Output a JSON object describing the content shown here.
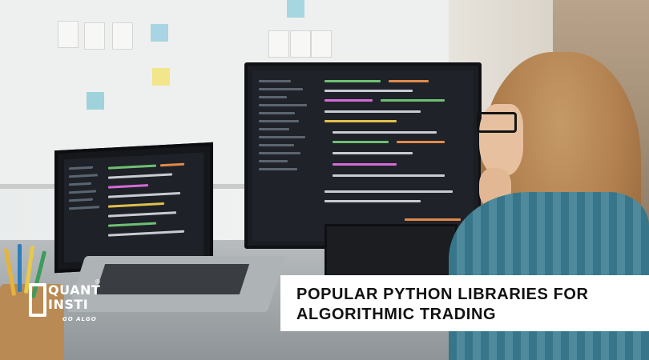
{
  "logo": {
    "line1": "QUANT",
    "line2": "INSTI",
    "tagline": "GO ALGO",
    "registered": "®"
  },
  "headline": {
    "text": "POPULAR PYTHON LIBRARIES FOR ALGORITHMIC TRADING"
  },
  "colors": {
    "headline_bg": "#ffffff",
    "headline_text": "#111111",
    "logo": "#ffffff"
  }
}
